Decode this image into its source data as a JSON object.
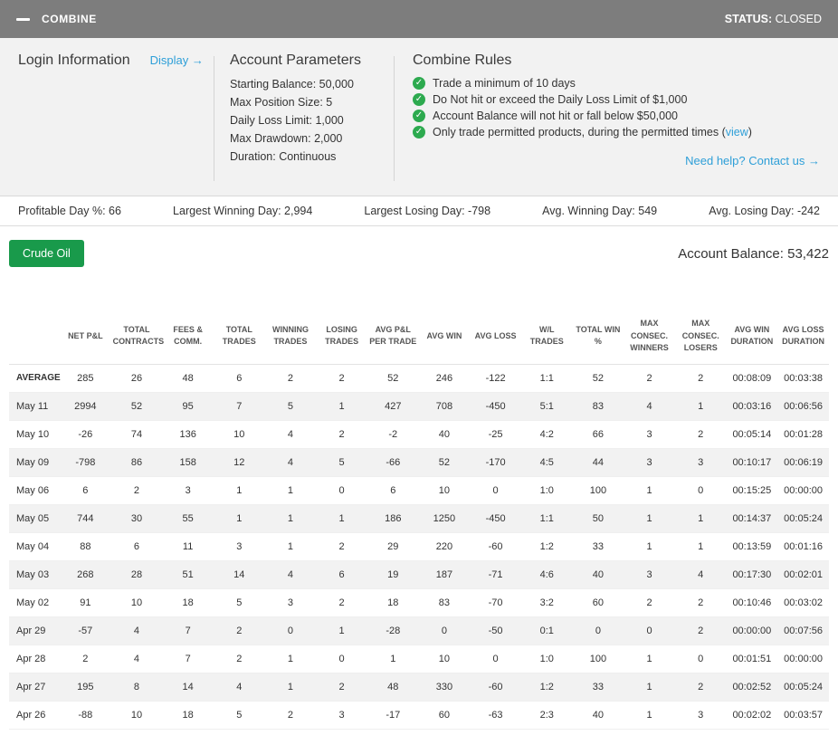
{
  "icons": {
    "check": "✓"
  },
  "topbar": {
    "title": "COMBINE",
    "status_label": "STATUS:",
    "status_value": "CLOSED"
  },
  "panel": {
    "login": {
      "title": "Login Information",
      "display_link": "Display →"
    },
    "params": {
      "title": "Account Parameters",
      "lines": [
        "Starting Balance: 50,000",
        "Max Position Size: 5",
        "Daily Loss Limit: 1,000",
        "Max Drawdown: 2,000",
        "Duration: Continuous"
      ]
    },
    "rules": {
      "title": "Combine Rules",
      "items": [
        {
          "text": "Trade a minimum of 10 days",
          "link": "",
          "suffix": ""
        },
        {
          "text": "Do Not hit or exceed the Daily Loss Limit of $1,000",
          "link": "",
          "suffix": ""
        },
        {
          "text": "Account Balance will not hit or fall below $50,000",
          "link": "",
          "suffix": ""
        },
        {
          "text": "Only trade permitted products, during the permitted times (",
          "link": "view",
          "suffix": ")"
        }
      ]
    },
    "help_link": "Need help? Contact us →"
  },
  "stats": [
    "Profitable Day %: 66",
    "Largest Winning Day: 2,994",
    "Largest Losing Day: -798",
    "Avg. Winning Day: 549",
    "Avg. Losing Day: -242"
  ],
  "account": {
    "product_button": "Crude Oil",
    "balance_label": "Account Balance: 53,422"
  },
  "table": {
    "columns": [
      "NET P&L",
      "TOTAL CONTRACTS",
      "FEES & COMM.",
      "TOTAL TRADES",
      "WINNING TRADES",
      "LOSING TRADES",
      "AVG P&L PER TRADE",
      "AVG WIN",
      "AVG LOSS",
      "W/L TRADES",
      "TOTAL WIN %",
      "MAX CONSEC. WINNERS",
      "MAX CONSEC. LOSERS",
      "AVG WIN DURATION",
      "AVG LOSS DURATION"
    ],
    "rows": [
      {
        "label": "AVERAGE",
        "values": [
          "285",
          "26",
          "48",
          "6",
          "2",
          "2",
          "52",
          "246",
          "-122",
          "1:1",
          "52",
          "2",
          "2",
          "00:08:09",
          "00:03:38"
        ]
      },
      {
        "label": "May 11",
        "values": [
          "2994",
          "52",
          "95",
          "7",
          "5",
          "1",
          "427",
          "708",
          "-450",
          "5:1",
          "83",
          "4",
          "1",
          "00:03:16",
          "00:06:56"
        ]
      },
      {
        "label": "May 10",
        "values": [
          "-26",
          "74",
          "136",
          "10",
          "4",
          "2",
          "-2",
          "40",
          "-25",
          "4:2",
          "66",
          "3",
          "2",
          "00:05:14",
          "00:01:28"
        ]
      },
      {
        "label": "May 09",
        "values": [
          "-798",
          "86",
          "158",
          "12",
          "4",
          "5",
          "-66",
          "52",
          "-170",
          "4:5",
          "44",
          "3",
          "3",
          "00:10:17",
          "00:06:19"
        ]
      },
      {
        "label": "May 06",
        "values": [
          "6",
          "2",
          "3",
          "1",
          "1",
          "0",
          "6",
          "10",
          "0",
          "1:0",
          "100",
          "1",
          "0",
          "00:15:25",
          "00:00:00"
        ]
      },
      {
        "label": "May 05",
        "values": [
          "744",
          "30",
          "55",
          "1",
          "1",
          "1",
          "186",
          "1250",
          "-450",
          "1:1",
          "50",
          "1",
          "1",
          "00:14:37",
          "00:05:24"
        ]
      },
      {
        "label": "May 04",
        "values": [
          "88",
          "6",
          "11",
          "3",
          "1",
          "2",
          "29",
          "220",
          "-60",
          "1:2",
          "33",
          "1",
          "1",
          "00:13:59",
          "00:01:16"
        ]
      },
      {
        "label": "May 03",
        "values": [
          "268",
          "28",
          "51",
          "14",
          "4",
          "6",
          "19",
          "187",
          "-71",
          "4:6",
          "40",
          "3",
          "4",
          "00:17:30",
          "00:02:01"
        ]
      },
      {
        "label": "May 02",
        "values": [
          "91",
          "10",
          "18",
          "5",
          "3",
          "2",
          "18",
          "83",
          "-70",
          "3:2",
          "60",
          "2",
          "2",
          "00:10:46",
          "00:03:02"
        ]
      },
      {
        "label": "Apr 29",
        "values": [
          "-57",
          "4",
          "7",
          "2",
          "0",
          "1",
          "-28",
          "0",
          "-50",
          "0:1",
          "0",
          "0",
          "2",
          "00:00:00",
          "00:07:56"
        ]
      },
      {
        "label": "Apr 28",
        "values": [
          "2",
          "4",
          "7",
          "2",
          "1",
          "0",
          "1",
          "10",
          "0",
          "1:0",
          "100",
          "1",
          "0",
          "00:01:51",
          "00:00:00"
        ]
      },
      {
        "label": "Apr 27",
        "values": [
          "195",
          "8",
          "14",
          "4",
          "1",
          "2",
          "48",
          "330",
          "-60",
          "1:2",
          "33",
          "1",
          "2",
          "00:02:52",
          "00:05:24"
        ]
      },
      {
        "label": "Apr 26",
        "values": [
          "-88",
          "10",
          "18",
          "5",
          "2",
          "3",
          "-17",
          "60",
          "-63",
          "2:3",
          "40",
          "1",
          "3",
          "00:02:02",
          "00:03:57"
        ]
      }
    ]
  }
}
